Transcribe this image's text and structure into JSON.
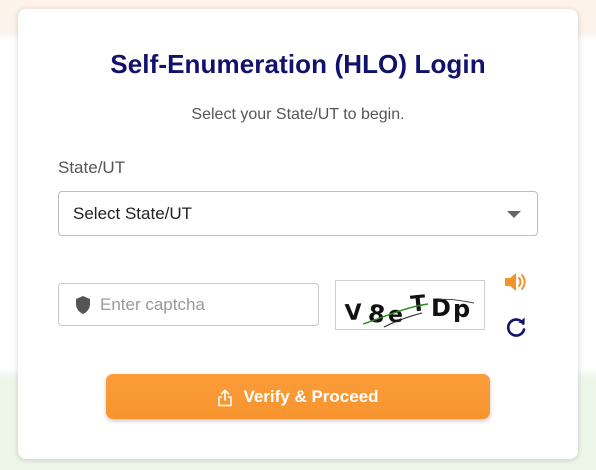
{
  "login": {
    "title": "Self-Enumeration (HLO) Login",
    "subtitle": "Select your State/UT to begin."
  },
  "state": {
    "label": "State/UT",
    "selected": "Select State/UT"
  },
  "captcha": {
    "placeholder": "Enter captcha",
    "image_text": "V8eTDp"
  },
  "actions": {
    "verify_label": "Verify & Proceed"
  },
  "icons": {
    "shield": "shield-icon",
    "audio": "speaker-icon",
    "refresh": "refresh-icon",
    "share": "share-icon",
    "caret": "chevron-down-icon"
  },
  "colors": {
    "title": "#12116b",
    "accent": "#f7942e",
    "refresh": "#12116b"
  }
}
